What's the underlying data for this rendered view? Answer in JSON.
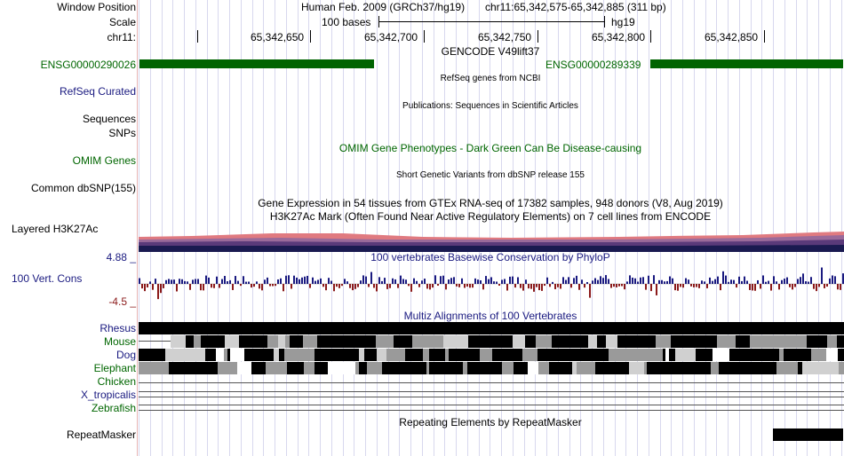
{
  "header": {
    "window_position_label": "Window Position",
    "scale_label": "Scale",
    "chrom_label": "chr11:",
    "assembly": "Human Feb. 2009 (GRCh37/hg19)",
    "position": "chr11:65,342,575-65,342,885 (311 bp)",
    "scale_text": "100 bases",
    "scale_db": "hg19",
    "ticks": [
      "65,342,650",
      "65,342,700",
      "65,342,750",
      "65,342,800",
      "65,342,850"
    ]
  },
  "tracks": {
    "gencode": {
      "title": "GENCODE V49lift37",
      "left_gene": "ENSG00000290026",
      "right_gene": "ENSG00000289339"
    },
    "refseq": {
      "label": "RefSeq Curated",
      "title": "RefSeq genes from NCBI"
    },
    "publications": {
      "title": "Publications: Sequences in Scientific Articles"
    },
    "sequences_label": "Sequences",
    "snps_label": "SNPs",
    "omim": {
      "label": "OMIM Genes",
      "title": "OMIM Gene Phenotypes - Dark Green Can Be Disease-causing"
    },
    "dbsnp": {
      "label": "Common dbSNP(155)",
      "title": "Short Genetic Variants from dbSNP release 155"
    },
    "gtex": {
      "title": "Gene Expression in 54 tissues from GTEx RNA-seq of 17382 samples, 948 donors (V8, Aug 2019)"
    },
    "h3k27ac": {
      "label": "Layered H3K27Ac",
      "title": "H3K27Ac Mark (Often Found Near Active Regulatory Elements) on 7 cell lines from ENCODE"
    },
    "conservation": {
      "label": "100 Vert. Cons",
      "max": "4.88 _",
      "min": "-4.5 _",
      "title": "100 vertebrates Basewise Conservation by PhyloP"
    },
    "multiz": {
      "title": "Multiz Alignments of 100 Vertebrates",
      "species": [
        "Rhesus",
        "Mouse",
        "Dog",
        "Elephant",
        "Chicken",
        "X_tropicalis",
        "Zebrafish"
      ]
    },
    "repeatmasker": {
      "label": "RepeatMasker",
      "title": "Repeating Elements by RepeatMasker"
    }
  },
  "colors": {
    "gene": "#006400",
    "navy": "#1a1a80",
    "cons_pos": "#1a1a80",
    "cons_neg": "#8b1a1a"
  }
}
